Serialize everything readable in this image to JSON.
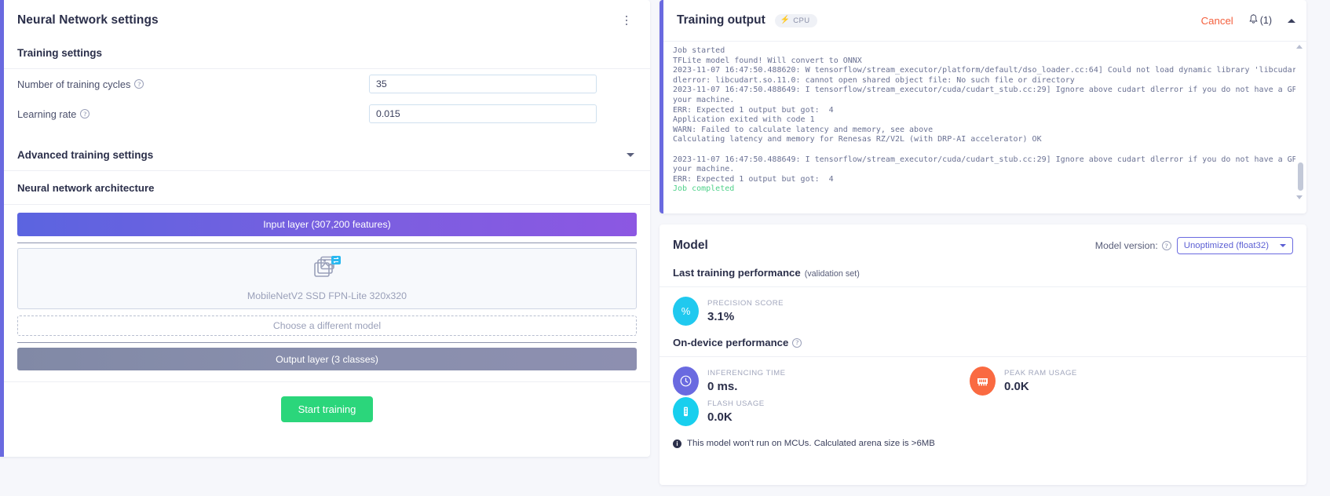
{
  "left": {
    "title": "Neural Network settings",
    "menu_icon": "kebab-menu-icon",
    "training_settings_label": "Training settings",
    "fields": [
      {
        "label": "Number of training cycles",
        "value": "35"
      },
      {
        "label": "Learning rate",
        "value": "0.015"
      }
    ],
    "advanced_label": "Advanced training settings",
    "architecture_label": "Neural network architecture",
    "input_layer": "Input layer (307,200 features)",
    "model_name": "MobileNetV2 SSD FPN-Lite 320x320",
    "choose_model": "Choose a different model",
    "output_layer": "Output layer (3 classes)",
    "start_training": "Start training"
  },
  "training_output": {
    "title": "Training output",
    "cpu_badge": "CPU",
    "cancel": "Cancel",
    "notifications": "(1)",
    "log": "Job started\nTFLite model found! Will convert to ONNX\n2023-11-07 16:47:50.488620: W tensorflow/stream_executor/platform/default/dso_loader.cc:64] Could not load dynamic library 'libcudart.so.11.0';\ndlerror: libcudart.so.11.0: cannot open shared object file: No such file or directory\n2023-11-07 16:47:50.488649: I tensorflow/stream_executor/cuda/cudart_stub.cc:29] Ignore above cudart dlerror if you do not have a GPU set up on\nyour machine.\nERR: Expected 1 output but got:  4\nApplication exited with code 1\nWARN: Failed to calculate latency and memory, see above\nCalculating latency and memory for Renesas RZ/V2L (with DRP-AI accelerator) OK\n\n2023-11-07 16:47:50.488649: I tensorflow/stream_executor/cuda/cudart_stub.cc:29] Ignore above cudart dlerror if you do not have a GPU set up on\nyour machine.\nERR: Expected 1 output but got:  4\n",
    "log_done": "Job completed"
  },
  "model": {
    "title": "Model",
    "version_label": "Model version:",
    "version_value": "Unoptimized (float32)",
    "last_training_performance": "Last training performance",
    "last_training_performance_sub": "(validation set)",
    "precision": {
      "caption": "PRECISION SCORE",
      "value": "3.1%",
      "icon": "percent-icon"
    },
    "on_device_performance": "On-device performance",
    "inferencing": {
      "caption": "INFERENCING TIME",
      "value": "0 ms.",
      "icon": "clock-icon"
    },
    "peak_ram": {
      "caption": "PEAK RAM USAGE",
      "value": "0.0K",
      "icon": "ram-icon"
    },
    "flash": {
      "caption": "FLASH USAGE",
      "value": "0.0K",
      "icon": "chip-icon"
    },
    "note": "This model won't run on MCUs. Calculated arena size is >6MB"
  },
  "colors": {
    "accent_purple": "#6a6ae0",
    "green": "#2bd67b",
    "cancel_red": "#f4603e",
    "cyan": "#20c9ef",
    "orange": "#fa6a41"
  }
}
